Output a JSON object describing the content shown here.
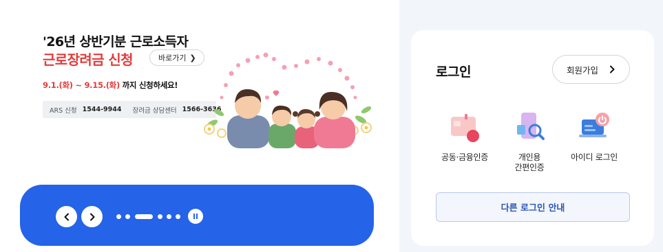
{
  "banner": {
    "title": "'26년 상반기분 근로소득자",
    "subtitle": "근로장려금 신청",
    "shortcut_label": "바로가기",
    "period_start": "9.1.(화)",
    "period_sep": " ~ ",
    "period_end": "9.15.(화)",
    "period_suffix": " 까지 신청하세요!",
    "contacts": [
      {
        "label": "ARS 신청",
        "number": "1544-9944"
      },
      {
        "label": "장려금 상담센터",
        "number": "1566-3636"
      }
    ]
  },
  "carousel": {
    "prev_icon": "chevron-left-icon",
    "next_icon": "chevron-right-icon",
    "pause_icon": "pause-icon",
    "slide_count": 6,
    "active_index": 2
  },
  "login": {
    "title": "로그인",
    "signup_label": "회원가입",
    "methods": [
      {
        "label": "공동·금융인증",
        "icon": "certificate-card-icon"
      },
      {
        "label_line1": "개인용",
        "label_line2": "간편인증",
        "icon": "mobile-auth-icon"
      },
      {
        "label": "아이디 로그인",
        "icon": "laptop-login-icon"
      }
    ],
    "other_login_label": "다른 로그인 안내"
  },
  "colors": {
    "accent_blue": "#2563e8",
    "accent_red": "#e33b3b",
    "page_bg": "#f2f5fa"
  }
}
